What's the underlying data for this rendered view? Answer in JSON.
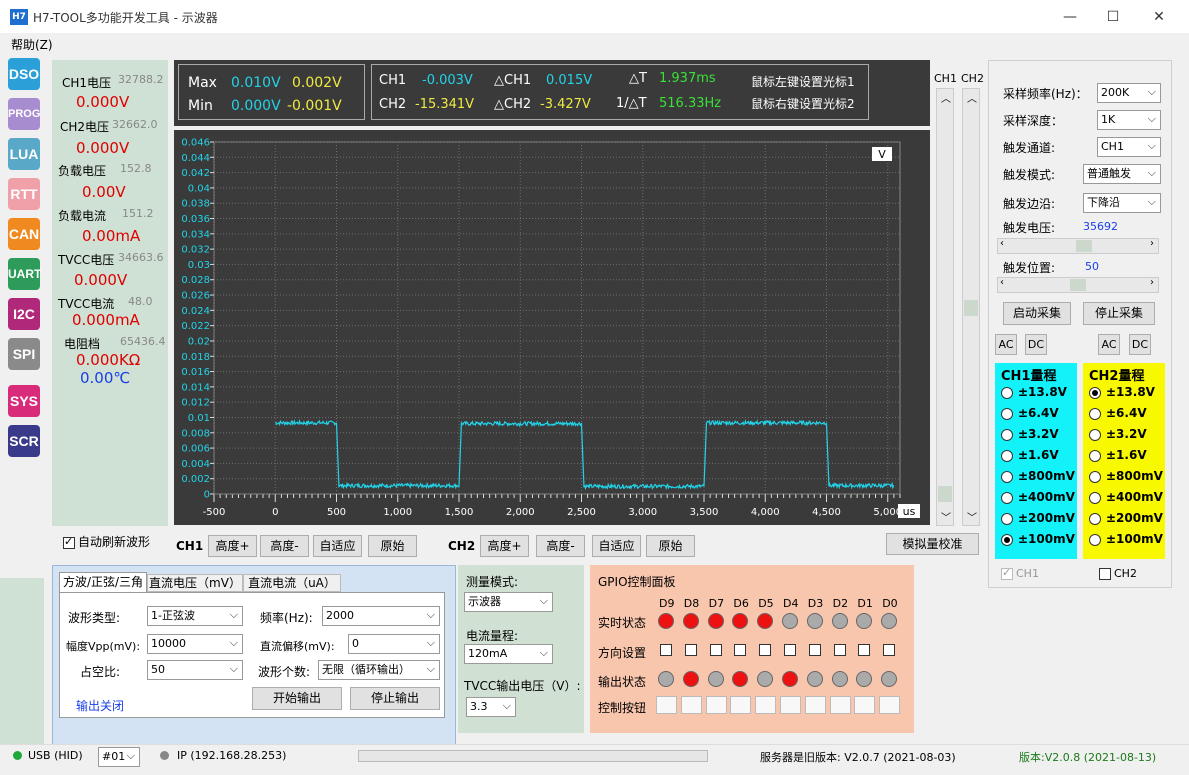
{
  "window": {
    "icon_text": "H7",
    "title": "H7-TOOL多功能开发工具 - 示波器",
    "minimize": "—",
    "maximize": "☐",
    "close": "✕"
  },
  "menu": {
    "help": "帮助(Z)"
  },
  "nav": [
    {
      "label": "DSO",
      "color": "#2a9fd8"
    },
    {
      "label": "PROG",
      "color": "#a88cd0"
    },
    {
      "label": "LUA",
      "color": "#5aa8c8"
    },
    {
      "label": "RTT",
      "color": "#f0a0a8"
    },
    {
      "label": "CAN",
      "color": "#f08a20"
    },
    {
      "label": "UART",
      "color": "#2d9b5a"
    },
    {
      "label": "I2C",
      "color": "#b0287a"
    },
    {
      "label": "SPI",
      "color": "#8a8a8a"
    },
    {
      "label": "SYS",
      "color": "#d82c7a"
    },
    {
      "label": "SCR",
      "color": "#3a3a8a"
    }
  ],
  "measurements": [
    {
      "label": "CH1电压",
      "raw": "32788.2",
      "value": "0.000V"
    },
    {
      "label": "CH2电压",
      "raw": "32662.0",
      "value": "0.000V"
    },
    {
      "label": "负载电压",
      "raw": "152.8",
      "value": "0.00V"
    },
    {
      "label": "负载电流",
      "raw": "151.2",
      "value": "0.00mA"
    },
    {
      "label": "TVCC电压",
      "raw": "34663.6",
      "value": "0.000V"
    },
    {
      "label": "TVCC电流",
      "raw": "48.0",
      "value": "0.000mA"
    },
    {
      "label": "电阻档",
      "raw": "65436.4",
      "value": "0.000KΩ"
    }
  ],
  "temperature": "0.00℃",
  "readouts": {
    "max_label": "Max",
    "min_label": "Min",
    "max_ch1": "0.010V",
    "max_ch2": "0.002V",
    "min_ch1": "0.000V",
    "min_ch2": "-0.001V",
    "ch1_label": "CH1",
    "ch2_label": "CH2",
    "ch1_val": "-0.003V",
    "ch2_val": "-15.341V",
    "dch1_label": "△CH1",
    "dch2_label": "△CH2",
    "dch1_val": "0.015V",
    "dch2_val": "-3.427V",
    "dt_label": "△T",
    "inv_dt_label": "1/△T",
    "dt_val": "1.937ms",
    "inv_dt_val": "516.33Hz",
    "cursor1_hint": "鼠标左键设置光标1",
    "cursor2_hint": "鼠标右键设置光标2"
  },
  "chart_data": {
    "type": "line",
    "title": "",
    "xlabel": "us",
    "ylabel": "V",
    "xlim": [
      -500,
      5100
    ],
    "ylim": [
      0,
      0.046
    ],
    "x_ticks": [
      "-500",
      "0",
      "500",
      "1,000",
      "1,500",
      "2,000",
      "2,500",
      "3,000",
      "3,500",
      "4,000",
      "4,500",
      "5,000"
    ],
    "y_ticks": [
      "0",
      "0.002",
      "0.004",
      "0.006",
      "0.008",
      "0.01",
      "0.012",
      "0.014",
      "0.016",
      "0.018",
      "0.02",
      "0.022",
      "0.024",
      "0.026",
      "0.028",
      "0.03",
      "0.032",
      "0.034",
      "0.036",
      "0.038",
      "0.04",
      "0.042",
      "0.044",
      "0.046"
    ],
    "grid": true,
    "series": [
      {
        "color": "#22d3e8",
        "x": [
          0,
          500,
          520,
          1500,
          1520,
          2500,
          2520,
          3500,
          3520,
          4500,
          4520,
          5050
        ],
        "y": [
          0.0093,
          0.0093,
          0.0011,
          0.0011,
          0.0092,
          0.0092,
          0.001,
          0.001,
          0.0093,
          0.0093,
          0.0011,
          0.0011
        ]
      }
    ]
  },
  "scroll_labels": {
    "ch1": "CH1",
    "ch2": "CH2"
  },
  "settings": {
    "sample_rate_label": "采样频率(Hz)：",
    "sample_rate": "200K",
    "sample_depth_label": "采样深度：",
    "sample_depth": "1K",
    "trigger_channel_label": "触发通道:",
    "trigger_channel": "CH1",
    "trigger_mode_label": "触发模式:",
    "trigger_mode": "普通触发",
    "trigger_edge_label": "触发边沿:",
    "trigger_edge": "下降沿",
    "trigger_voltage_label": "触发电压:",
    "trigger_voltage": "35692",
    "trigger_position_label": "触发位置:",
    "trigger_position": "50",
    "start_label": "启动采集",
    "stop_label": "停止采集",
    "ac": "AC",
    "dc": "DC",
    "ch1_range_title": "CH1量程",
    "ch2_range_title": "CH2量程",
    "ranges": [
      "±13.8V",
      "±6.4V",
      "±3.2V",
      "±1.6V",
      "±800mV",
      "±400mV",
      "±200mV",
      "±100mV"
    ],
    "ch1_selected": 7,
    "ch2_selected": 0,
    "ch1_check": "CH1",
    "ch2_check": "CH2"
  },
  "controls": {
    "auto_refresh": "自动刷新波形",
    "ch1": "CH1",
    "ch2": "CH2",
    "height_plus": "高度+",
    "height_minus": "高度-",
    "auto_fit": "自适应",
    "original": "原始",
    "analog_calib": "模拟量校准"
  },
  "wave_panel": {
    "tabs": [
      "方波/正弦/三角",
      "直流电压（mV）",
      "直流电流（uA）"
    ],
    "wave_type_label": "波形类型:",
    "wave_type": "1-正弦波",
    "freq_label": "频率(Hz):",
    "freq": "2000",
    "vpp_label": "幅度Vpp(mV):",
    "vpp": "10000",
    "offset_label": "直流偏移(mV):",
    "offset": "0",
    "duty_label": "占空比:",
    "duty": "50",
    "count_label": "波形个数:",
    "count": "无限（循环输出）",
    "start": "开始输出",
    "stop": "停止输出",
    "output_off": "输出关闭"
  },
  "measure_mode": {
    "mode_label": "测量模式:",
    "mode": "示波器",
    "current_range_label": "电流量程:",
    "current_range": "120mA",
    "tvcc_label": "TVCC输出电压（V）:",
    "tvcc": "3.3"
  },
  "gpio": {
    "title": "GPIO控制面板",
    "pins": [
      "D9",
      "D8",
      "D7",
      "D6",
      "D5",
      "D4",
      "D3",
      "D2",
      "D1",
      "D0"
    ],
    "realtime_label": "实时状态",
    "direction_label": "方向设置",
    "output_label": "输出状态",
    "control_label": "控制按钮",
    "realtime": [
      1,
      1,
      1,
      1,
      1,
      0,
      0,
      0,
      0,
      0
    ],
    "output": [
      0,
      1,
      0,
      1,
      0,
      1,
      0,
      0,
      0,
      0
    ]
  },
  "status": {
    "usb": "USB (HID)",
    "device": "#01",
    "ip": "IP (192.168.28.253)",
    "server": "服务器是旧版本: V2.0.7 (2021-08-03)",
    "version": "版本:V2.0.8 (2021-08-13)"
  }
}
